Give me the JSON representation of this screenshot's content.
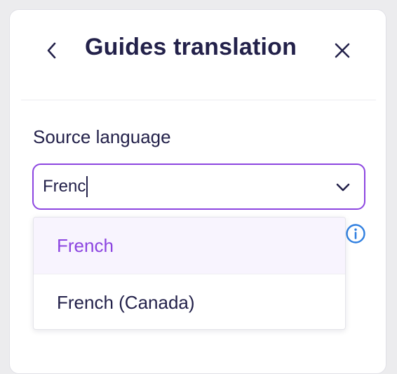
{
  "header": {
    "title": "Guides translation",
    "back_icon": "chevron-left-icon",
    "close_icon": "close-icon"
  },
  "source_language": {
    "label": "Source language",
    "input_value": "Frenc",
    "dropdown_icon": "chevron-down-icon",
    "info_icon": "info-icon",
    "options": [
      {
        "label": "French",
        "highlighted": true
      },
      {
        "label": "French (Canada)",
        "highlighted": false
      }
    ]
  },
  "colors": {
    "accent": "#8c45e0",
    "text": "#23214a",
    "info": "#2f7fe0",
    "highlight_bg": "#f8f4fe"
  }
}
